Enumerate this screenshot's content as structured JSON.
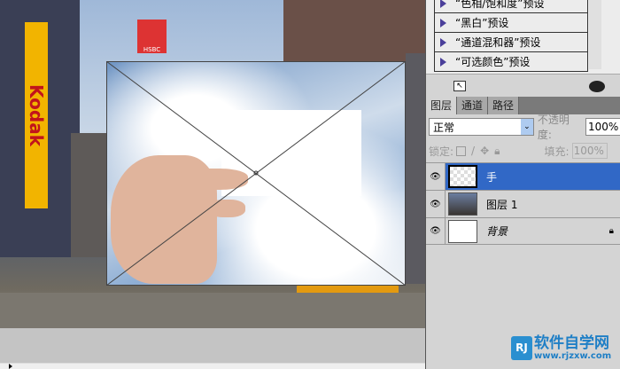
{
  "canvas": {
    "signs": {
      "kodak": "Kodak",
      "hsbc": "HSBC"
    }
  },
  "adjustments": {
    "items": [
      "“色相/饱和度”预设",
      "“黑白”预设",
      "“通道混和器”预设",
      "“可选颜色”预设"
    ]
  },
  "layers_panel": {
    "tabs": [
      "图层",
      "通道",
      "路径"
    ],
    "blend_mode": "正常",
    "opacity_label": "不透明度:",
    "opacity": "100%",
    "lock_label": "锁定:",
    "fill_label": "填充:",
    "fill": "100%",
    "layers": [
      {
        "name": "手",
        "selected": true
      },
      {
        "name": "图层 1"
      },
      {
        "name": "背景",
        "locked": true
      }
    ]
  },
  "watermark": {
    "brand": "软件自学网",
    "url": "www.rjzxw.com"
  }
}
